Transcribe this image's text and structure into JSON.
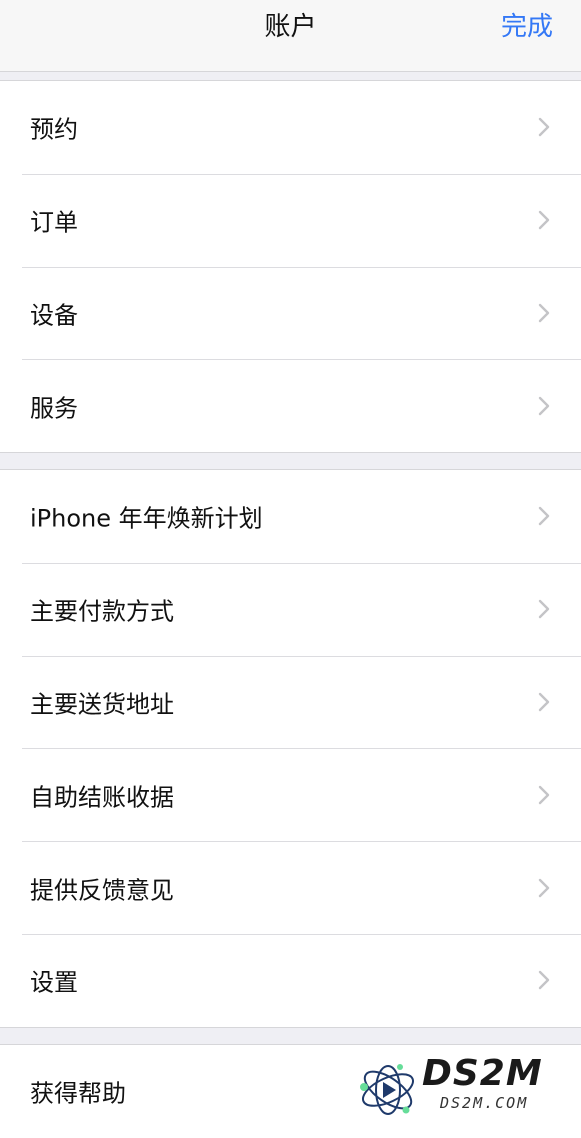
{
  "nav": {
    "title": "账户",
    "done_label": "完成"
  },
  "group1": {
    "items": [
      {
        "label": "预约"
      },
      {
        "label": "订单"
      },
      {
        "label": "设备"
      },
      {
        "label": "服务"
      }
    ]
  },
  "group2": {
    "items": [
      {
        "label": "iPhone 年年焕新计划"
      },
      {
        "label": "主要付款方式"
      },
      {
        "label": "主要送货地址"
      },
      {
        "label": "自助结账收据"
      },
      {
        "label": "提供反馈意见"
      },
      {
        "label": "设置"
      }
    ]
  },
  "group3": {
    "items": [
      {
        "label": "获得帮助"
      }
    ]
  },
  "watermark": {
    "brand": "DS2M",
    "domain": "DS2M.COM"
  },
  "colors": {
    "accent": "#3478f6",
    "background": "#efeff4",
    "chevron": "#c4c4c7"
  },
  "icons": {
    "disclosure": "chevron-right-icon"
  }
}
